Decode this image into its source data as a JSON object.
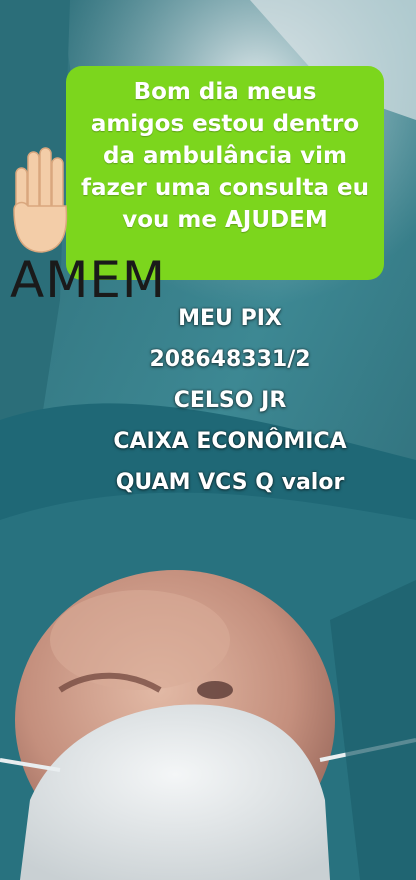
{
  "caption": {
    "lines": [
      "Bom dia meus",
      "amigos estou dentro",
      "da ambulância vim",
      "fazer uma consulta eu",
      "vou me AJUDEM"
    ]
  },
  "sticker": {
    "hand_icon": "raised-hand-icon",
    "word": "AMEM"
  },
  "pix": {
    "lines": [
      "MEU PIX",
      "208648331/2",
      "CELSO JR",
      "CAIXA ECONÔMICA",
      "QUAM VCS  Q valor"
    ]
  },
  "colors": {
    "caption_bg": "#7cd61d",
    "text": "#ffffff"
  }
}
